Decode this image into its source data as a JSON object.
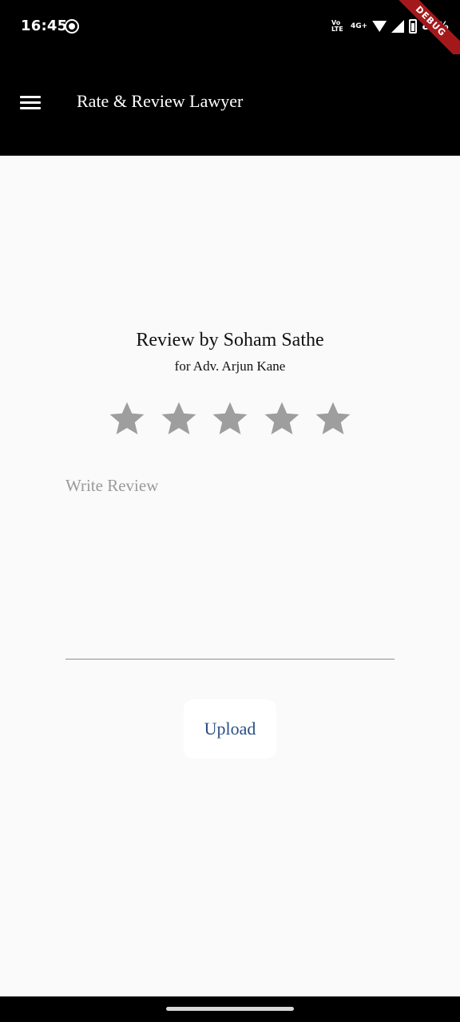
{
  "status_bar": {
    "time": "16:45",
    "network": "Vo LTE",
    "signal_label": "4G+",
    "battery": "82%",
    "debug_banner": "DEBUG"
  },
  "app_bar": {
    "title": "Rate & Review Lawyer",
    "menu_icon": "menu-icon"
  },
  "review": {
    "title": "Review by Soham Sathe",
    "subtitle": "for Adv. Arjun Kane",
    "rating": 0,
    "max_rating": 5,
    "star_color": "#9e9e9e"
  },
  "review_input": {
    "placeholder": "Write Review",
    "value": ""
  },
  "actions": {
    "upload_label": "Upload",
    "upload_color": "#2a4f87"
  }
}
